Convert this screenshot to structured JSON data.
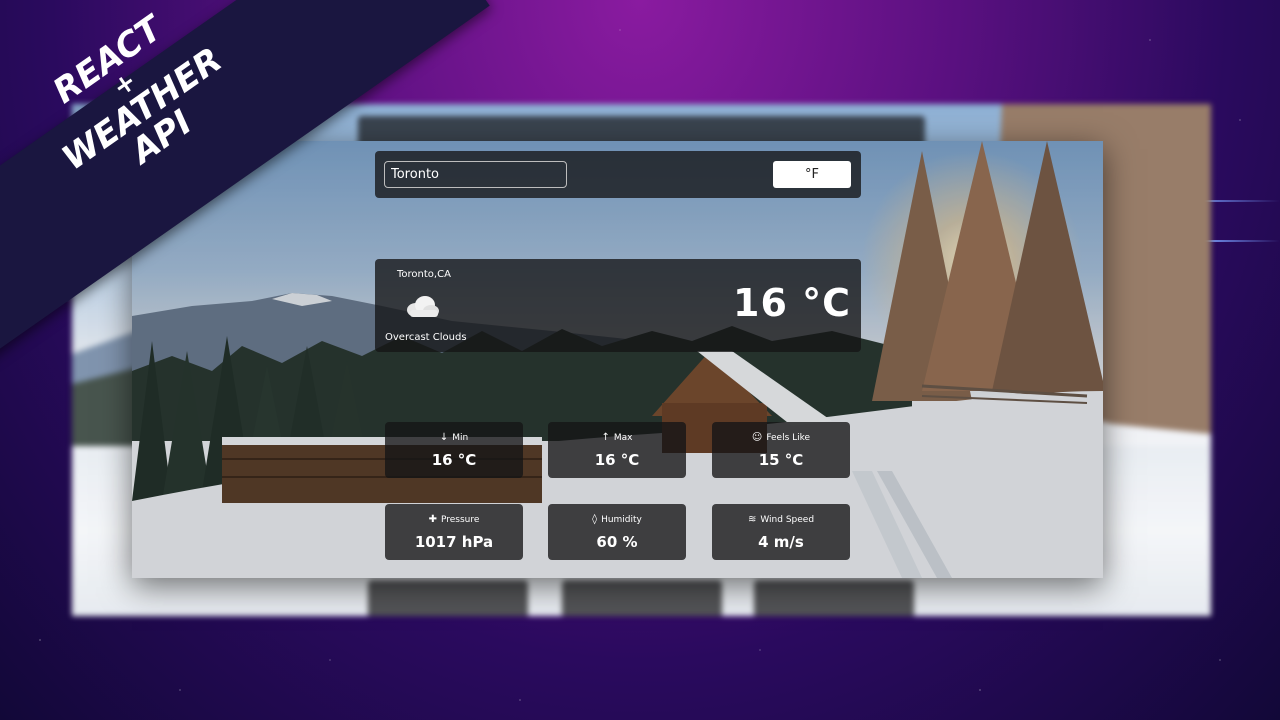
{
  "banner": {
    "line1": "REACT",
    "line2": "+",
    "line3": "WEATHER API"
  },
  "search": {
    "value": "Toronto"
  },
  "unit_toggle": {
    "label": "°F"
  },
  "current": {
    "location": "Toronto,CA",
    "icon": "cloud-icon",
    "description": "Overcast Clouds",
    "temperature": "16 °C"
  },
  "stats": [
    {
      "icon": "arrow-down-icon",
      "label": "Min",
      "value": "16 °C"
    },
    {
      "icon": "arrow-up-icon",
      "label": "Max",
      "value": "16 °C"
    },
    {
      "icon": "face-icon",
      "label": "Feels Like",
      "value": "15 °C"
    },
    {
      "icon": "pressure-icon",
      "label": "Pressure",
      "value": "1017 hPa"
    },
    {
      "icon": "droplet-icon",
      "label": "Humidity",
      "value": "60 %"
    },
    {
      "icon": "wind-icon",
      "label": "Wind Speed",
      "value": "4 m/s"
    }
  ],
  "colors": {
    "background_top": "#8a1ba0",
    "background_bottom": "#120838",
    "panel": "#141416",
    "banner": "#1a1640"
  }
}
